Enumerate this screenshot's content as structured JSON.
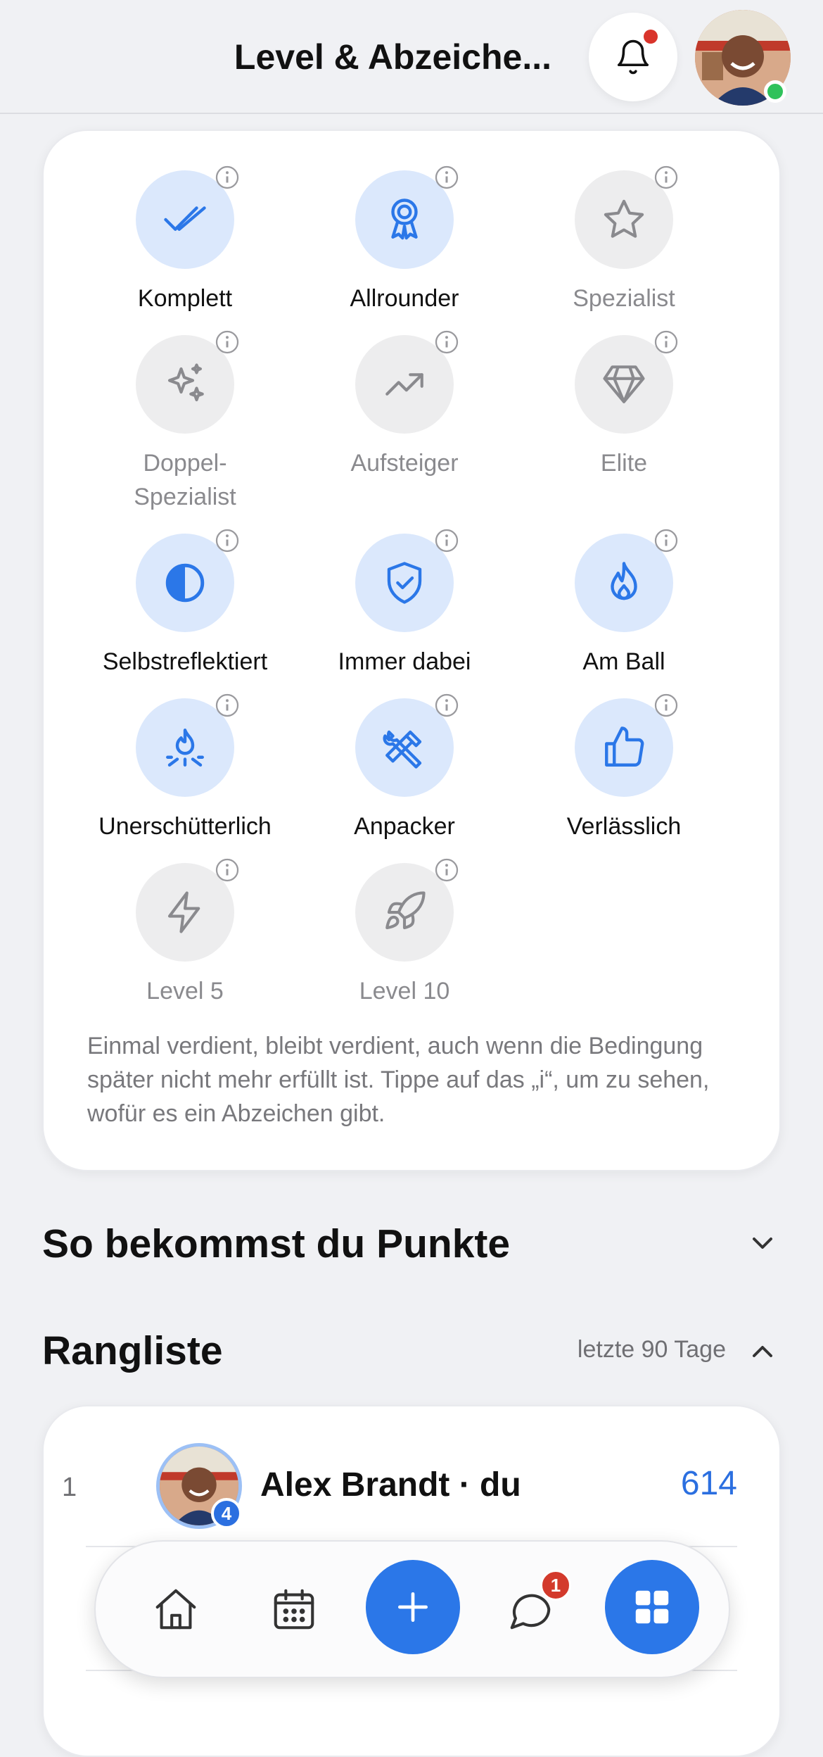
{
  "header": {
    "title": "Level & Abzeiche...",
    "online": true
  },
  "badges": [
    {
      "label": "Komplett",
      "icon": "double-check-icon",
      "earned": true
    },
    {
      "label": "Allrounder",
      "icon": "award-rosette-icon",
      "earned": true
    },
    {
      "label": "Spezialist",
      "icon": "star-icon",
      "earned": false
    },
    {
      "label": "Doppel-\nSpezialist",
      "icon": "sparkles-icon",
      "earned": false
    },
    {
      "label": "Aufsteiger",
      "icon": "trending-up-icon",
      "earned": false
    },
    {
      "label": "Elite",
      "icon": "diamond-icon",
      "earned": false
    },
    {
      "label": "Selbstreflektiert",
      "icon": "half-circle-icon",
      "earned": true
    },
    {
      "label": "Immer dabei",
      "icon": "shield-check-icon",
      "earned": true
    },
    {
      "label": "Am Ball",
      "icon": "flame-icon",
      "earned": true
    },
    {
      "label": "Unerschütterlich",
      "icon": "campfire-icon",
      "earned": true
    },
    {
      "label": "Anpacker",
      "icon": "tools-icon",
      "earned": true
    },
    {
      "label": "Verlässlich",
      "icon": "thumbs-up-icon",
      "earned": true
    },
    {
      "label": "Level 5",
      "icon": "lightning-icon",
      "earned": false
    },
    {
      "label": "Level 10",
      "icon": "rocket-icon",
      "earned": false
    }
  ],
  "badges_note": "Einmal verdient, bleibt verdient, auch wenn die Bedingung später nicht mehr erfüllt ist. Tippe auf das „i“, um zu sehen, wofür es ein Abzeichen gibt.",
  "points_section": {
    "title": "So bekommst du Punkte",
    "expanded": false
  },
  "ranking": {
    "title": "Rangliste",
    "period": "letzte 90 Tage",
    "expanded": true,
    "rows": [
      {
        "rank": "1",
        "name": "Alex Brandt · du",
        "level": "4",
        "points": "614"
      }
    ]
  },
  "bottom_nav": {
    "chat_unread": "1",
    "items": [
      "home-icon",
      "calendar-icon",
      "plus-icon",
      "chat-icon",
      "grid-icon"
    ]
  },
  "colors": {
    "accent": "#2b77e8",
    "badge_active_bg": "#dbe8fc",
    "badge_inactive_bg": "#ededee",
    "notification_dot": "#d9342b",
    "online": "#2fc25b"
  }
}
